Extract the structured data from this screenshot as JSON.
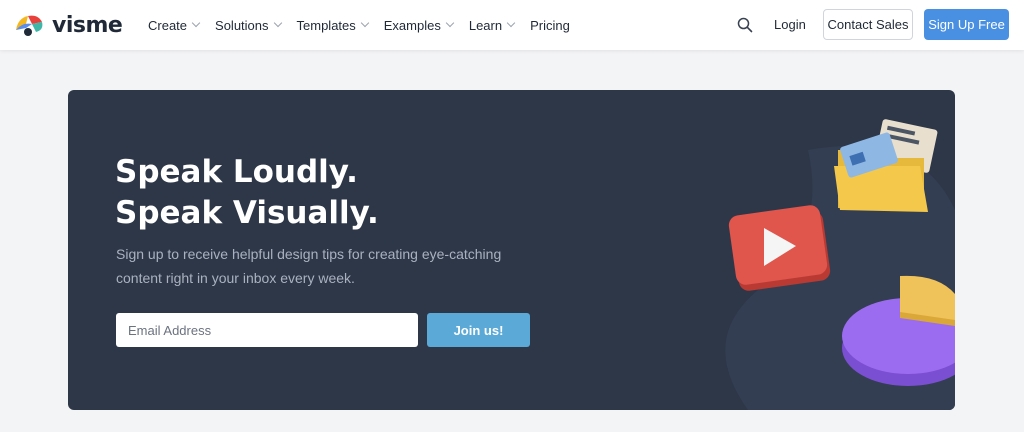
{
  "brand": {
    "name": "visme"
  },
  "nav": {
    "items": [
      {
        "label": "Create",
        "has_dropdown": true
      },
      {
        "label": "Solutions",
        "has_dropdown": true
      },
      {
        "label": "Templates",
        "has_dropdown": true
      },
      {
        "label": "Examples",
        "has_dropdown": true
      },
      {
        "label": "Learn",
        "has_dropdown": true
      },
      {
        "label": "Pricing",
        "has_dropdown": false
      }
    ],
    "search_icon": "search-icon",
    "login_label": "Login",
    "contact_label": "Contact Sales",
    "signup_label": "Sign Up Free"
  },
  "hero": {
    "headline_line1": "Speak Loudly.",
    "headline_line2": "Speak Visually.",
    "subtext": "Sign up to receive helpful design tips for creating eye-catching content right in your inbox every week.",
    "email_placeholder": "Email Address",
    "join_label": "Join us!"
  },
  "colors": {
    "hero_bg": "#2d3748",
    "signup_bg": "#4a90e2",
    "join_bg": "#5aa9d6"
  }
}
